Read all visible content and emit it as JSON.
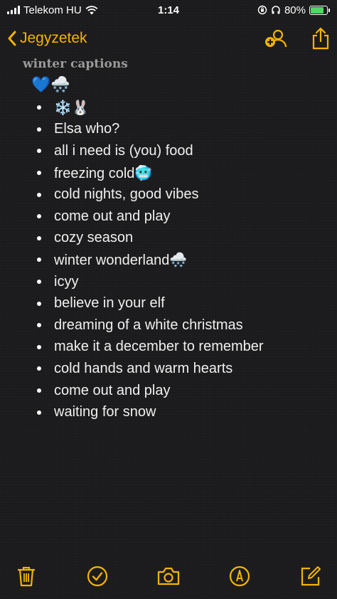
{
  "status_bar": {
    "carrier": "Telekom HU",
    "time": "1:14",
    "battery_percent": "80%",
    "battery_level": 0.8,
    "icons": [
      "signal-icon",
      "wifi-icon",
      "rotation-lock-icon",
      "headphones-icon",
      "battery-icon"
    ]
  },
  "nav": {
    "back_label": "Jegyzetek",
    "icons": [
      "chevron-left-icon",
      "add-people-icon",
      "share-icon"
    ]
  },
  "note": {
    "title": "winter captions",
    "emoji_line": "💙🌨️",
    "items": [
      "❄️🐰",
      "Elsa who?",
      "all i need is (you) food",
      "freezing cold🥶",
      "cold nights, good vibes",
      "come out and play",
      "cozy season",
      "winter wonderland🌨️",
      "icyy",
      "believe in your elf",
      "dreaming of a white christmas",
      "make it a december to remember",
      "cold hands and warm hearts",
      "come out and play",
      "waiting for snow"
    ]
  },
  "toolbar": {
    "icons": [
      "trash-icon",
      "checklist-icon",
      "camera-icon",
      "markup-icon",
      "compose-icon"
    ]
  },
  "colors": {
    "accent": "#f5b400",
    "background": "#1c1c1e",
    "text": "#f0f0f0",
    "battery_fill": "#4cd964"
  }
}
